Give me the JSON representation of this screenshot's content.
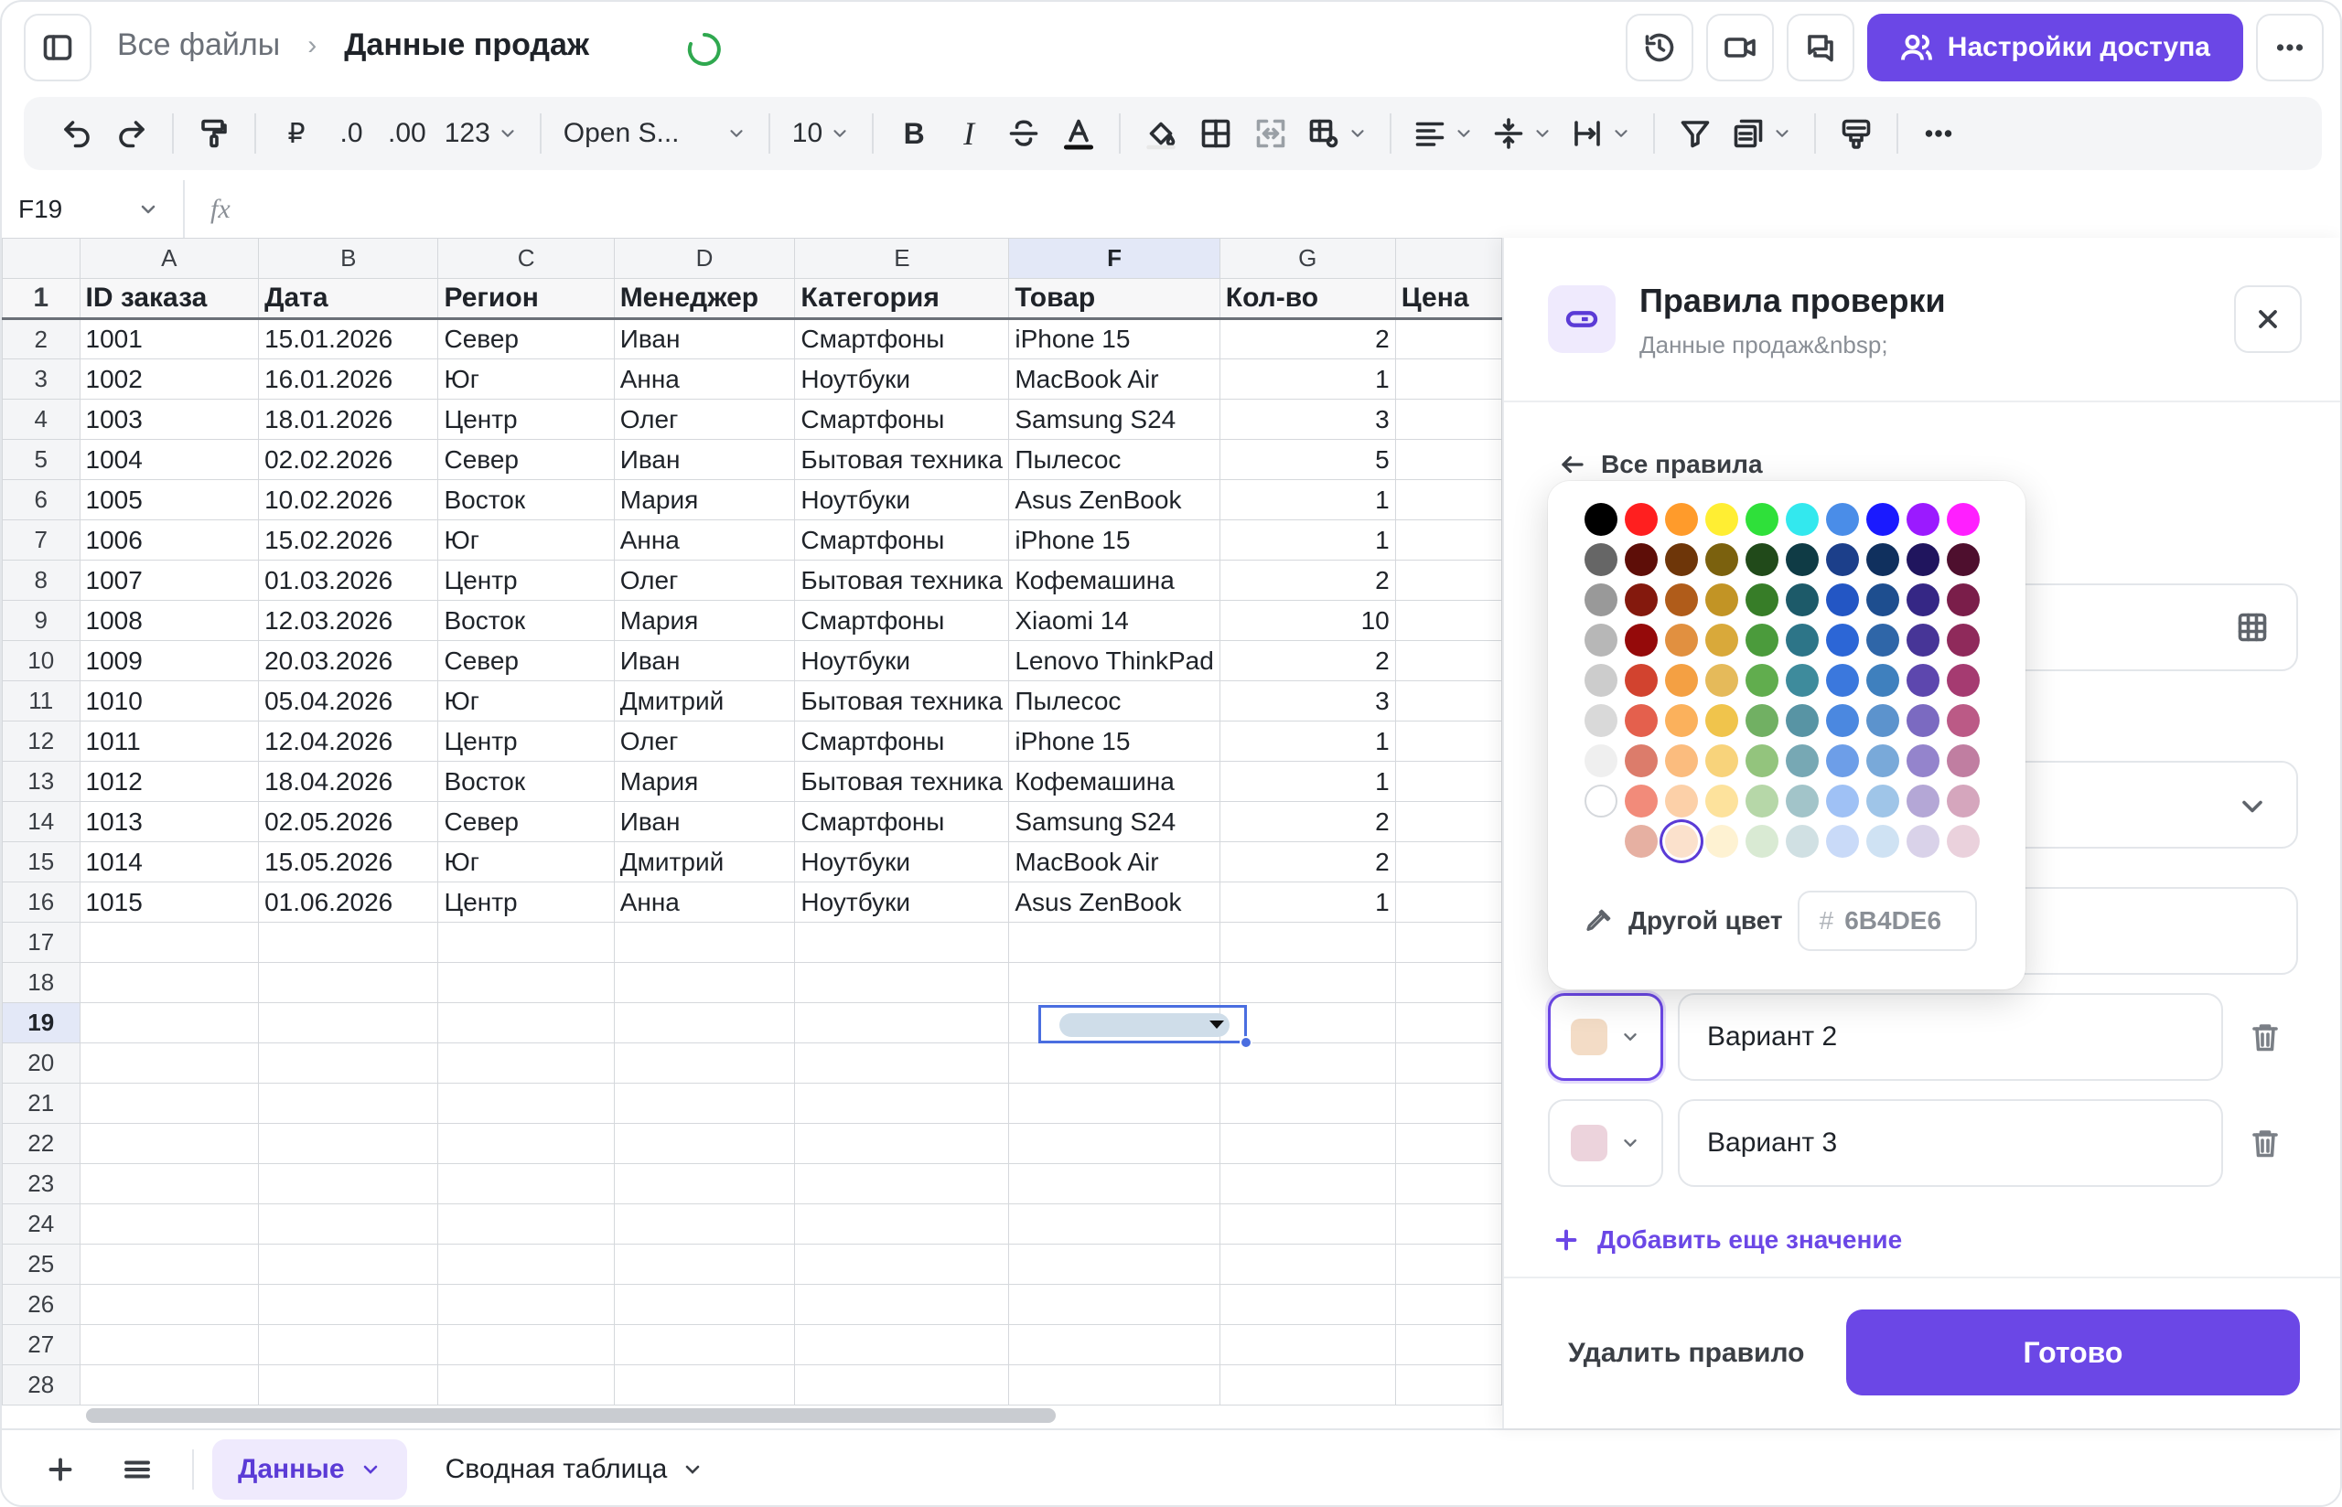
{
  "header": {
    "breadcrumb_root": "Все файлы",
    "breadcrumb_sep": "›",
    "title": "Данные продаж",
    "share_label": "Настройки доступа"
  },
  "toolbar": {
    "currency": "₽",
    "dec_less": ".0",
    "dec_more": ".00",
    "number_format": "123",
    "font": "Open S...",
    "font_size": "10",
    "bold": "B",
    "italic": "I"
  },
  "formula": {
    "cell_ref": "F19",
    "fx": "fx"
  },
  "grid": {
    "columns": [
      "A",
      "B",
      "C",
      "D",
      "E",
      "F",
      "G",
      ""
    ],
    "headers": [
      "ID заказа",
      "Дата",
      "Регион",
      "Менеджер",
      "Категория",
      "Товар",
      "Кол-во",
      "Цена"
    ],
    "rows": [
      [
        "1001",
        "15.01.2026",
        "Север",
        "Иван",
        "Смартфоны",
        "iPhone 15",
        "2"
      ],
      [
        "1002",
        "16.01.2026",
        "Юг",
        "Анна",
        "Ноутбуки",
        "MacBook Air",
        "1"
      ],
      [
        "1003",
        "18.01.2026",
        "Центр",
        "Олег",
        "Смартфоны",
        "Samsung S24",
        "3"
      ],
      [
        "1004",
        "02.02.2026",
        "Север",
        "Иван",
        "Бытовая техника",
        "Пылесос",
        "5"
      ],
      [
        "1005",
        "10.02.2026",
        "Восток",
        "Мария",
        "Ноутбуки",
        "Asus ZenBook",
        "1"
      ],
      [
        "1006",
        "15.02.2026",
        "Юг",
        "Анна",
        "Смартфоны",
        "iPhone 15",
        "1"
      ],
      [
        "1007",
        "01.03.2026",
        "Центр",
        "Олег",
        "Бытовая техника",
        "Кофемашина",
        "2"
      ],
      [
        "1008",
        "12.03.2026",
        "Восток",
        "Мария",
        "Смартфоны",
        "Xiaomi 14",
        "10"
      ],
      [
        "1009",
        "20.03.2026",
        "Север",
        "Иван",
        "Ноутбуки",
        "Lenovo ThinkPad",
        "2"
      ],
      [
        "1010",
        "05.04.2026",
        "Юг",
        "Дмитрий",
        "Бытовая техника",
        "Пылесос",
        "3"
      ],
      [
        "1011",
        "12.04.2026",
        "Центр",
        "Олег",
        "Смартфоны",
        "iPhone 15",
        "1"
      ],
      [
        "1012",
        "18.04.2026",
        "Восток",
        "Мария",
        "Бытовая техника",
        "Кофемашина",
        "1"
      ],
      [
        "1013",
        "02.05.2026",
        "Север",
        "Иван",
        "Смартфоны",
        "Samsung S24",
        "2"
      ],
      [
        "1014",
        "15.05.2026",
        "Юг",
        "Дмитрий",
        "Ноутбуки",
        "MacBook Air",
        "2"
      ],
      [
        "1015",
        "01.06.2026",
        "Центр",
        "Анна",
        "Ноутбуки",
        "Asus ZenBook",
        "1"
      ]
    ],
    "row_numbers": [
      "1",
      "2",
      "3",
      "4",
      "5",
      "6",
      "7",
      "8",
      "9",
      "10",
      "11",
      "12",
      "13",
      "14",
      "15",
      "16",
      "17",
      "18",
      "19",
      "20",
      "21",
      "22",
      "23",
      "24",
      "25",
      "26",
      "27",
      "28"
    ],
    "selected_row": "19",
    "selected_col": "F"
  },
  "sheets": {
    "tabs": [
      {
        "label": "Данные",
        "active": true
      },
      {
        "label": "Сводная таблица",
        "active": false
      }
    ]
  },
  "panel": {
    "title": "Правила проверки",
    "subtitle": "Данные продаж&nbsp;",
    "back_label": "Все правила",
    "options": [
      {
        "label": "Вариант 2",
        "color": "#f3dcc6",
        "active": true
      },
      {
        "label": "Вариант 3",
        "color": "#ecd3dc",
        "active": false
      }
    ],
    "add_label": "Добавить еще значение",
    "delete_label": "Удалить правило",
    "done_label": "Готово"
  },
  "color_picker": {
    "custom_label": "Другой цвет",
    "hex_prefix": "#",
    "hex_value": "6B4DE6",
    "selected": "#fbe1cc",
    "rows": [
      [
        "#000000",
        "#ff1f1f",
        "#ff9b2b",
        "#ffee33",
        "#2fe03a",
        "#33e8ee",
        "#4a8de8",
        "#1a1aff",
        "#9b1aff",
        "#ff1fff"
      ],
      [
        "#666666",
        "#5e0e08",
        "#6e3609",
        "#7b610e",
        "#214a1a",
        "#0f3b45",
        "#1c3f8a",
        "#10305e",
        "#20155e",
        "#4e0f2e"
      ],
      [
        "#999999",
        "#84190d",
        "#b05c1a",
        "#c29425",
        "#377d28",
        "#1d5a69",
        "#2356c4",
        "#1e4e8f",
        "#352785",
        "#7a1e4a"
      ],
      [
        "#b7b7b7",
        "#950a0a",
        "#e19040",
        "#d9a93a",
        "#4b9b3c",
        "#2d7588",
        "#2c66d6",
        "#2f66a8",
        "#473597",
        "#8f2a5b"
      ],
      [
        "#cccccc",
        "#d2432f",
        "#f4a043",
        "#e5ba5a",
        "#61ad4e",
        "#3e8b9c",
        "#3b78dd",
        "#3f80be",
        "#5d47ae",
        "#a53b71"
      ],
      [
        "#d9d9d9",
        "#e4604d",
        "#fbb15c",
        "#f0c44c",
        "#71b063",
        "#5894a4",
        "#4b88e0",
        "#5c93cd",
        "#7b6ac1",
        "#bb5a86"
      ],
      [
        "#efefef",
        "#dc7c6b",
        "#fbbc7e",
        "#f8d37b",
        "#93c47d",
        "#77a8b4",
        "#6d9ee8",
        "#79a9d9",
        "#9484cc",
        "#c07ea1"
      ],
      [
        "#ffffff",
        "#f28b7a",
        "#fcd0a8",
        "#fde29c",
        "#b6d7a8",
        "#a2c4c9",
        "#9fc1f5",
        "#9fc5e8",
        "#b4a7d6",
        "#d5a6bd"
      ],
      [
        "",
        "#e6b0a2",
        "#fbe1cc",
        "#fef2d2",
        "#d9ead3",
        "#d0e0e3",
        "#c9daf8",
        "#cfe2f3",
        "#d9d2e9",
        "#ead1dc"
      ]
    ]
  }
}
